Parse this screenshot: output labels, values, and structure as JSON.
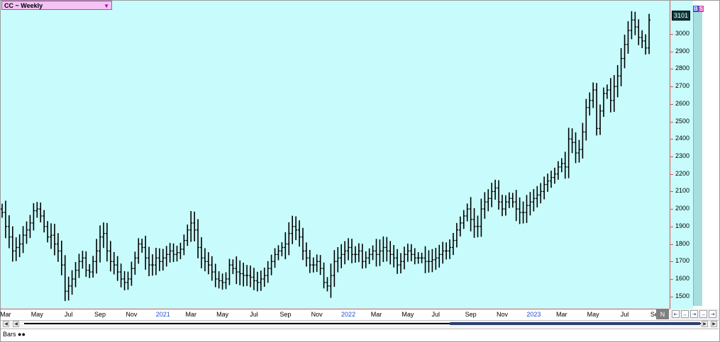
{
  "symbol": {
    "label": "CC ~ Weekly",
    "dropdown_icon": "caret-down-icon"
  },
  "price_tag": "3101",
  "badge": {
    "b": "B",
    "s": "S"
  },
  "nav": {
    "n_label": "N"
  },
  "study": {
    "label": "Bars",
    "icon": "glasses-icon"
  },
  "colors": {
    "plot_bg": "#c8fcfc",
    "axis_line": "#e05050",
    "bar": "#000000",
    "year_label": "#2050d0"
  },
  "chart_data": {
    "type": "ohlc",
    "title": "CC ~ Weekly",
    "xlabel": "",
    "ylabel": "",
    "ylim": [
      1430,
      3190
    ],
    "grid": false,
    "yticks": [
      1500,
      1600,
      1700,
      1800,
      1900,
      2000,
      2100,
      2200,
      2300,
      2400,
      2500,
      2600,
      2700,
      2800,
      2900,
      3000
    ],
    "xticks": [
      {
        "label": "Mar",
        "week": 1,
        "year": false
      },
      {
        "label": "May",
        "week": 10,
        "year": false
      },
      {
        "label": "Jul",
        "week": 19,
        "year": false
      },
      {
        "label": "Sep",
        "week": 28,
        "year": false
      },
      {
        "label": "Nov",
        "week": 37,
        "year": false
      },
      {
        "label": "2021",
        "week": 46,
        "year": true
      },
      {
        "label": "Mar",
        "week": 54,
        "year": false
      },
      {
        "label": "May",
        "week": 63,
        "year": false
      },
      {
        "label": "Jul",
        "week": 72,
        "year": false
      },
      {
        "label": "Sep",
        "week": 81,
        "year": false
      },
      {
        "label": "Nov",
        "week": 90,
        "year": false
      },
      {
        "label": "2022",
        "week": 99,
        "year": true
      },
      {
        "label": "Mar",
        "week": 107,
        "year": false
      },
      {
        "label": "May",
        "week": 116,
        "year": false
      },
      {
        "label": "Jul",
        "week": 124,
        "year": false
      },
      {
        "label": "Sep",
        "week": 134,
        "year": false
      },
      {
        "label": "Nov",
        "week": 143,
        "year": false
      },
      {
        "label": "2023",
        "week": 152,
        "year": true
      },
      {
        "label": "Mar",
        "week": 160,
        "year": false
      },
      {
        "label": "May",
        "week": 169,
        "year": false
      },
      {
        "label": "Jul",
        "week": 178,
        "year": false
      },
      {
        "label": "Sep",
        "week": 187,
        "year": false
      }
    ],
    "closes": [
      1980,
      1900,
      1840,
      1760,
      1780,
      1800,
      1850,
      1880,
      1920,
      1990,
      2000,
      1960,
      1900,
      1840,
      1850,
      1800,
      1760,
      1680,
      1530,
      1560,
      1600,
      1650,
      1700,
      1720,
      1650,
      1640,
      1700,
      1760,
      1840,
      1860,
      1760,
      1700,
      1680,
      1640,
      1600,
      1580,
      1600,
      1660,
      1720,
      1800,
      1780,
      1720,
      1680,
      1680,
      1720,
      1700,
      1720,
      1740,
      1760,
      1740,
      1750,
      1770,
      1820,
      1880,
      1920,
      1880,
      1780,
      1720,
      1700,
      1680,
      1640,
      1600,
      1590,
      1580,
      1600,
      1680,
      1660,
      1640,
      1630,
      1620,
      1620,
      1610,
      1590,
      1580,
      1600,
      1620,
      1660,
      1700,
      1740,
      1760,
      1780,
      1800,
      1860,
      1900,
      1880,
      1840,
      1760,
      1720,
      1680,
      1680,
      1700,
      1660,
      1580,
      1560,
      1620,
      1700,
      1720,
      1740,
      1760,
      1780,
      1740,
      1740,
      1760,
      1700,
      1720,
      1740,
      1760,
      1740,
      1760,
      1780,
      1760,
      1740,
      1720,
      1680,
      1700,
      1740,
      1760,
      1740,
      1720,
      1720,
      1720,
      1700,
      1700,
      1710,
      1720,
      1740,
      1760,
      1760,
      1780,
      1820,
      1880,
      1920,
      1960,
      2000,
      1940,
      1900,
      1900,
      2000,
      2040,
      2060,
      2100,
      2120,
      2040,
      2000,
      2040,
      2060,
      2040,
      2000,
      1980,
      1980,
      2020,
      2040,
      2060,
      2080,
      2100,
      2140,
      2160,
      2180,
      2200,
      2240,
      2260,
      2240,
      2400,
      2380,
      2320,
      2340,
      2440,
      2580,
      2620,
      2680,
      2460,
      2560,
      2660,
      2680,
      2620,
      2700,
      2760,
      2860,
      2940,
      3020,
      3080,
      3040,
      2980,
      2960,
      2920,
      3080
    ]
  }
}
